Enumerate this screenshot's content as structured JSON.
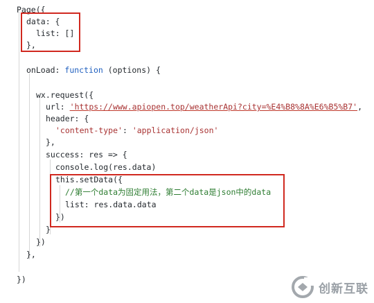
{
  "code": {
    "l1": "Page({",
    "l2": "data: {",
    "l3": "list: []",
    "l4": "},",
    "l5_fn": "onLoad:",
    "l5_kw": "function",
    "l5_rest": "(options) {",
    "l6": "wx.request({",
    "l7_key": "url:",
    "l7_url": "'https://www.apiopen.top/weatherApi?city=%E4%B8%8A%E6%B5%B7'",
    "l7_end": ",",
    "l8": "header: {",
    "l9_key": "'content-type'",
    "l9_sep": ":",
    "l9_val": "'application/json'",
    "l10": "},",
    "l11": "success: res => {",
    "l12": "console.log(res.data)",
    "l13": "this.setData({",
    "l14": "//第一个data为固定用法，第二个data是json中的data",
    "l15": "list: res.data.data",
    "l16": "})",
    "l17": "}",
    "l18": "})",
    "l19": "},",
    "l20": "})"
  },
  "watermark": {
    "text": "创新互联",
    "icon": "brand-logo-icon"
  }
}
